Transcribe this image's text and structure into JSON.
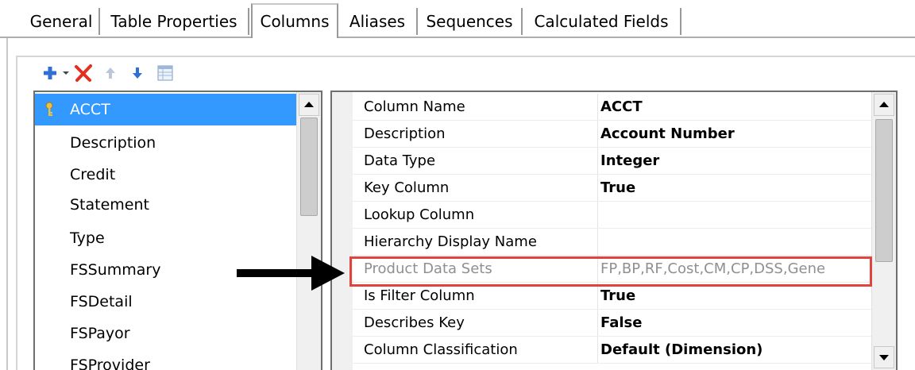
{
  "tabs": [
    {
      "label": "General"
    },
    {
      "label": "Table Properties"
    },
    {
      "label": "Columns"
    },
    {
      "label": "Aliases"
    },
    {
      "label": "Sequences"
    },
    {
      "label": "Calculated Fields"
    }
  ],
  "active_tab": "Columns",
  "toolbar": {
    "icons": [
      "add-icon",
      "dropdown-arrow-icon",
      "delete-icon",
      "move-up-icon",
      "move-down-icon",
      "properties-grid-icon"
    ]
  },
  "columns_list": {
    "selected": "ACCT",
    "items": [
      "ACCT",
      "Description",
      "Credit",
      "Statement",
      "Type",
      "FSSummary",
      "FSDetail",
      "FSPayor",
      "FSProvider"
    ]
  },
  "properties": [
    {
      "name": "Column Name",
      "value": "ACCT"
    },
    {
      "name": "Description",
      "value": "Account Number"
    },
    {
      "name": "Data Type",
      "value": "Integer"
    },
    {
      "name": "Key Column",
      "value": "True"
    },
    {
      "name": "Lookup Column",
      "value": ""
    },
    {
      "name": "Hierarchy Display Name",
      "value": ""
    },
    {
      "name": "Product Data Sets",
      "value": "FP,BP,RF,Cost,CM,CP,DSS,Gene"
    },
    {
      "name": "Is Filter Column",
      "value": "True"
    },
    {
      "name": "Describes Key",
      "value": "False"
    },
    {
      "name": "Column Classification",
      "value": "Default (Dimension)"
    }
  ],
  "annotation": {
    "highlighted_property": "Product Data Sets",
    "colors": {
      "highlight": "#e0443c",
      "selection": "#3399ff"
    }
  }
}
